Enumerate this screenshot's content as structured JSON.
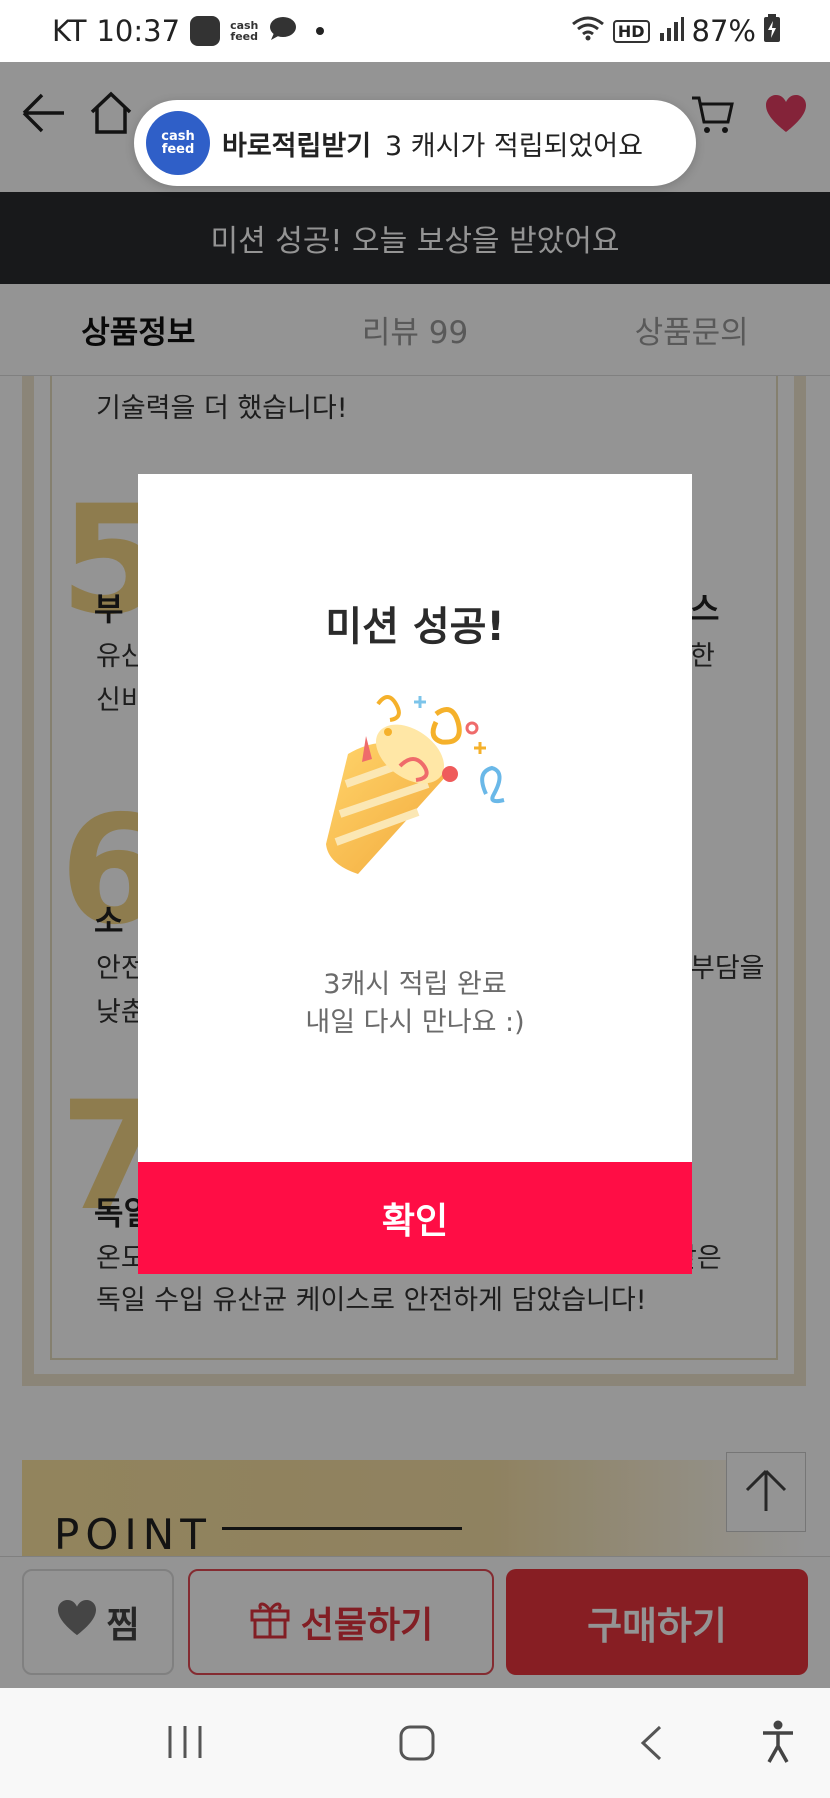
{
  "status_bar": {
    "carrier": "KT",
    "time": "10:37",
    "battery": "87%",
    "network": "HD",
    "cash_label": "cash\nfeed"
  },
  "top_nav": {
    "icons": [
      "back-arrow-icon",
      "home-icon",
      "cart-icon",
      "heart-icon"
    ]
  },
  "toast": {
    "logo_text_1": "cash",
    "logo_text_2": "feed",
    "title": "바로적립받기",
    "message": "3 캐시가 적립되었어요"
  },
  "mission_banner": {
    "text": "미션 성공! 오늘 보상을 받았어요"
  },
  "tabs": [
    {
      "label": "상품정보",
      "active": true
    },
    {
      "label": "리뷰 99",
      "active": false
    },
    {
      "label": "상품문의",
      "active": false
    }
  ],
  "content": {
    "line_top": "기술력을 더 했습니다!",
    "num5": "5",
    "item5_title_start": "부",
    "item5_title_end": "스",
    "item5_line1_start": "유산",
    "item5_line1_end": "한",
    "item5_line2": "신비",
    "num6": "6",
    "item6_title": "소",
    "item6_line1_start": "안전",
    "item6_line1_end": "부담을",
    "item6_line2": "낮춘",
    "num7": "7",
    "item7_title": "독일",
    "item7_line1_start": "온도",
    "item7_line1_end": "같은",
    "item7_line2": "독일 수입 유산균 케이스로 안전하게 담았습니다!",
    "point": "POINT"
  },
  "modal": {
    "title": "미션 성공!",
    "message_line1": "3캐시 적립 완료",
    "message_line2": "내일 다시 만나요 :)",
    "confirm": "확인"
  },
  "bottom_bar": {
    "zzim": "찜",
    "gift": "선물하기",
    "buy": "구매하기"
  }
}
